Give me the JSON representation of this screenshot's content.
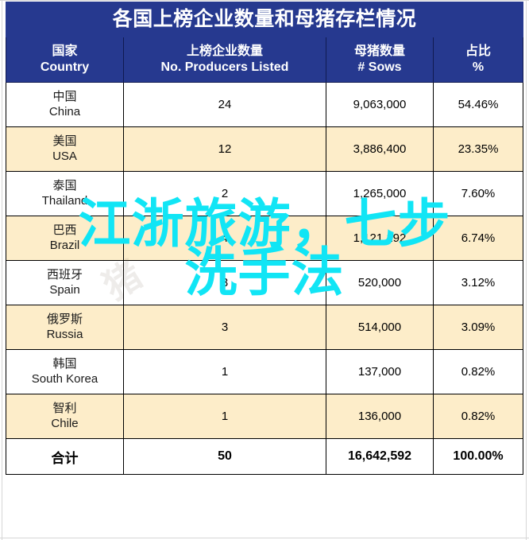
{
  "table": {
    "title": "各国上榜企业数量和母猪存栏情况",
    "columns": [
      {
        "cn": "国家",
        "en": "Country"
      },
      {
        "cn": "上榜企业数量",
        "en": "No. Producers Listed"
      },
      {
        "cn": "母猪数量",
        "en": "# Sows"
      },
      {
        "cn": "占比",
        "en": "%"
      }
    ],
    "rows": [
      {
        "country_cn": "中国",
        "country_en": "China",
        "producers": "24",
        "sows": "9,063,000",
        "share": "54.46%"
      },
      {
        "country_cn": "美国",
        "country_en": "USA",
        "producers": "12",
        "sows": "3,886,400",
        "share": "23.35%"
      },
      {
        "country_cn": "泰国",
        "country_en": "Thailand",
        "producers": "2",
        "sows": "1,265,000",
        "share": "7.60%"
      },
      {
        "country_cn": "巴西",
        "country_en": "Brazil",
        "producers": "4",
        "sows": "1,121,192",
        "share": "6.74%"
      },
      {
        "country_cn": "西班牙",
        "country_en": "Spain",
        "producers": "3",
        "sows": "520,000",
        "share": "3.12%"
      },
      {
        "country_cn": "俄罗斯",
        "country_en": "Russia",
        "producers": "3",
        "sows": "514,000",
        "share": "3.09%"
      },
      {
        "country_cn": "韩国",
        "country_en": "South Korea",
        "producers": "1",
        "sows": "137,000",
        "share": "0.82%"
      },
      {
        "country_cn": "智利",
        "country_en": "Chile",
        "producers": "1",
        "sows": "136,000",
        "share": "0.82%"
      }
    ],
    "total": {
      "label": "合计",
      "producers": "50",
      "sows": "16,642,592",
      "share": "100.00%"
    }
  },
  "overlay": {
    "line1": "江浙旅游，七步",
    "line2": "洗手法",
    "color": "#11E5F5"
  },
  "watermark": {
    "text": "猪"
  },
  "chart_data": {
    "type": "table",
    "title": "各国上榜企业数量和母猪存栏情况",
    "columns": [
      "国家 Country",
      "上榜企业数量 No. Producers Listed",
      "母猪数量 # Sows",
      "占比 %"
    ],
    "categories": [
      "China",
      "USA",
      "Thailand",
      "Brazil",
      "Spain",
      "Russia",
      "South Korea",
      "Chile"
    ],
    "series": [
      {
        "name": "No. Producers Listed",
        "values": [
          24,
          12,
          2,
          4,
          3,
          3,
          1,
          1
        ]
      },
      {
        "name": "# Sows",
        "values": [
          9063000,
          3886400,
          1265000,
          1121192,
          520000,
          514000,
          137000,
          136000
        ]
      },
      {
        "name": "Share %",
        "values": [
          54.46,
          23.35,
          7.6,
          6.74,
          3.12,
          3.09,
          0.82,
          0.82
        ]
      }
    ],
    "totals": {
      "producers": 50,
      "sows": 16642592,
      "share": 100.0
    }
  },
  "theme": {
    "header_blue": "#26398F",
    "alt_row_cream": "#FDEDC9",
    "border": "#000000"
  }
}
